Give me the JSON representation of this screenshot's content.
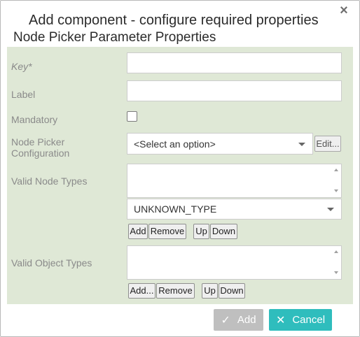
{
  "dialog": {
    "title": "Add component - configure required properties",
    "subtitle": "Node Picker Parameter Properties",
    "close_glyph": "×"
  },
  "form": {
    "key_label": "Key*",
    "label_label": "Label",
    "mandatory_label": "Mandatory",
    "mandatory_checked": false,
    "node_picker_label_line1": "Node Picker",
    "node_picker_label_line2": "Configuration",
    "node_picker_value": "<Select an option>",
    "edit_button": "Edit...",
    "valid_node_types_label": "Valid Node Types",
    "node_type_value": "UNKNOWN_TYPE",
    "node_buttons": {
      "add": "Add",
      "remove": "Remove",
      "up": "Up",
      "down": "Down"
    },
    "valid_object_types_label": "Valid Object Types",
    "object_buttons": {
      "add": "Add...",
      "remove": "Remove",
      "up": "Up",
      "down": "Down"
    }
  },
  "footer": {
    "add_icon": "✓",
    "add_label": "Add",
    "add_disabled": true,
    "cancel_icon": "✕",
    "cancel_label": "Cancel"
  },
  "colors": {
    "panel_bg": "#dfe8d6",
    "cancel_bg": "#2fbdbd",
    "add_disabled_bg": "#bfbfbf"
  }
}
